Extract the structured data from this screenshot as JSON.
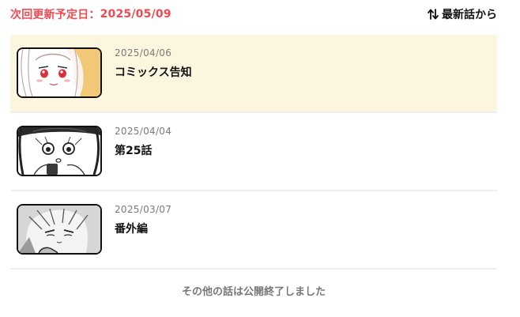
{
  "header": {
    "next_update_label": "次回更新予定日：",
    "next_update_date": "2025/05/09",
    "sort_label": "最新話から",
    "sort_icon": "sort-arrows-icon"
  },
  "episodes": [
    {
      "date": "2025/04/06",
      "title": "コミックス告知",
      "highlighted": true,
      "thumbnail": "manga-girl-red-eyes-thumbnail"
    },
    {
      "date": "2025/04/04",
      "title": "第25話",
      "highlighted": false,
      "thumbnail": "manga-girl-surprised-thumbnail"
    },
    {
      "date": "2025/03/07",
      "title": "番外編",
      "highlighted": false,
      "thumbnail": "manga-boy-thumbnail"
    }
  ],
  "footer": {
    "note": "その他の話は公開終了しました"
  },
  "colors": {
    "accent": "#f04a50",
    "highlight_row": "#fdf6df",
    "divider": "#eeeeee",
    "muted_text": "#7a7a7a"
  }
}
